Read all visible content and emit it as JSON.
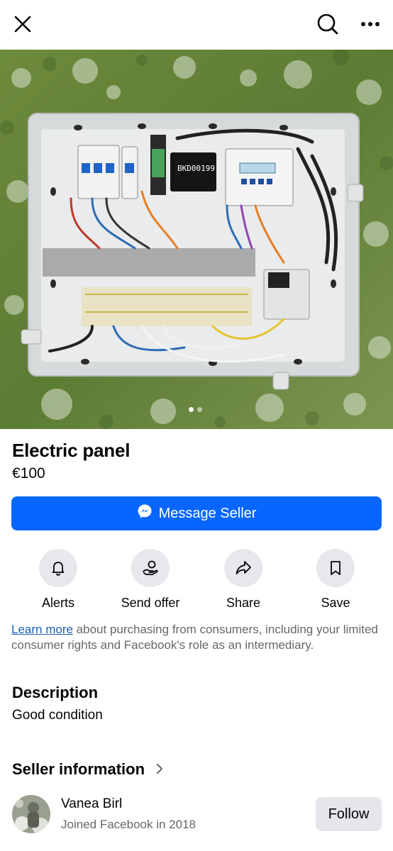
{
  "topbar": {
    "close_icon": "close-icon",
    "search_icon": "search-icon",
    "more_icon": "more-horizontal-icon"
  },
  "photo": {
    "label_text": "BKD00199",
    "carousel_pages": 2,
    "carousel_active": 1
  },
  "listing": {
    "title": "Electric panel",
    "price": "€100"
  },
  "message_button": {
    "label": "Message Seller",
    "icon": "messenger-icon",
    "color": "#0866ff"
  },
  "actions": [
    {
      "label": "Alerts",
      "icon": "bell-icon"
    },
    {
      "label": "Send offer",
      "icon": "offer-hand-icon"
    },
    {
      "label": "Share",
      "icon": "share-arrow-icon"
    },
    {
      "label": "Save",
      "icon": "bookmark-icon"
    }
  ],
  "legal": {
    "link": "Learn more",
    "text": " about purchasing from consumers, including your limited consumer rights and Facebook's role as an intermediary."
  },
  "description": {
    "heading": "Description",
    "text": "Good condition"
  },
  "seller": {
    "heading": "Seller information",
    "name": "Vanea Birl",
    "joined": "Joined Facebook in 2018",
    "follow_label": "Follow"
  }
}
